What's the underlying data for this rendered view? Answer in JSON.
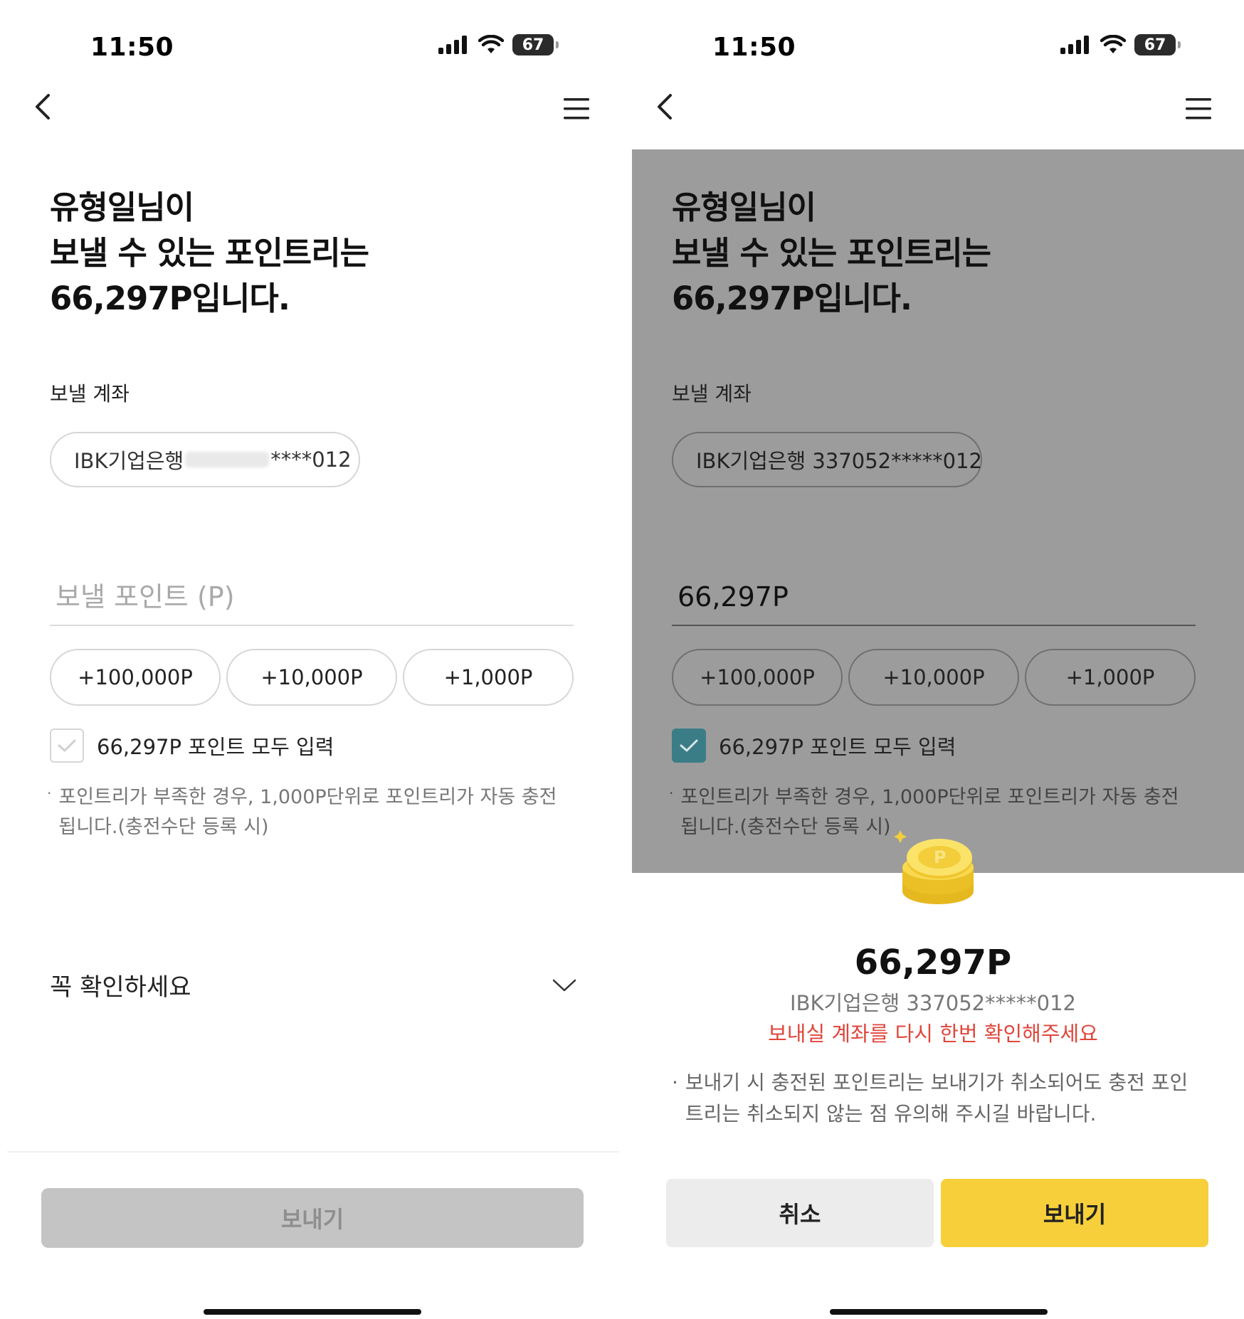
{
  "left": {
    "status": {
      "time": "11:50",
      "battery": "67"
    },
    "headline": {
      "line1": "유형일님이",
      "line2": "보낼 수 있는 포인트리는",
      "line3": "66,297P입니다."
    },
    "account_section_label": "보낼 계좌",
    "account": {
      "bank": "IBK기업은행",
      "masked_tail": "****012"
    },
    "points_input": {
      "placeholder": "보낼 포인트 (P)",
      "value": ""
    },
    "chips": [
      "+100,000P",
      "+10,000P",
      "+1,000P"
    ],
    "use_all": {
      "label": "66,297P 포인트 모두 입력",
      "checked": false
    },
    "note": "포인트리가 부족한 경우, 1,000P단위로 포인트리가 자동 충전 됩니다.(충전수단 등록 시)",
    "accordion_label": "꼭 확인하세요",
    "send_button": "보내기"
  },
  "right": {
    "status": {
      "time": "11:50",
      "battery": "67"
    },
    "headline": {
      "line1": "유형일님이",
      "line2": "보낼 수 있는 포인트리는",
      "line3": "66,297P입니다."
    },
    "account_section_label": "보낼 계좌",
    "account": {
      "text": "IBK기업은행 337052*****012"
    },
    "points_input": {
      "value": "66,297P"
    },
    "chips": [
      "+100,000P",
      "+10,000P",
      "+1,000P"
    ],
    "use_all": {
      "label": "66,297P 포인트 모두 입력",
      "checked": true
    },
    "note": "포인트리가 부족한 경우, 1,000P단위로 포인트리가 자동 충전 됩니다.(충전수단 등록 시)",
    "sheet": {
      "amount": "66,297P",
      "account": "IBK기업은행 337052*****012",
      "warning": "보내실 계좌를 다시 한번 확인해주세요",
      "note": "보내기 시 충전된 포인트리는 보내기가 취소되어도 충전 포인트리는 취소되지 않는 점 유의해 주시길 바랍니다.",
      "cancel_button": "취소",
      "send_button": "보내기"
    }
  },
  "colors": {
    "accent_yellow": "#f6cf3a",
    "check_teal": "#1f8fa2",
    "warning_red": "#e0463b",
    "disabled_gray": "#c4c4c4"
  }
}
